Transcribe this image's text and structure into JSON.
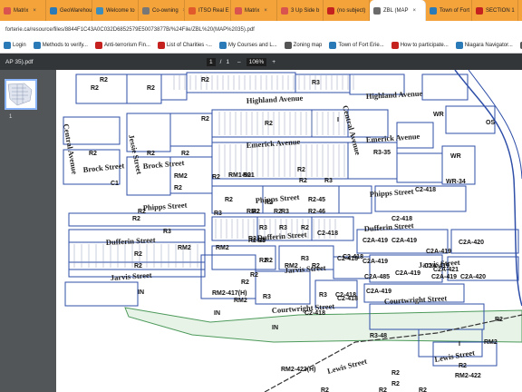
{
  "tabs": [
    {
      "label": "Matrix",
      "active": false,
      "color": "#d9534f"
    },
    {
      "label": "GeoWarehouse",
      "active": false,
      "color": "#2a7ab8"
    },
    {
      "label": "Welcome to",
      "active": false,
      "color": "#3c8dbc"
    },
    {
      "label": "Co-owning",
      "active": false,
      "color": "#777777"
    },
    {
      "label": "ITSO Real E",
      "active": false,
      "color": "#e05a2b"
    },
    {
      "label": "Matrix",
      "active": false,
      "color": "#d9534f"
    },
    {
      "label": "3 Up Side b",
      "active": false,
      "color": "#d9534f"
    },
    {
      "label": "(no subject)",
      "active": false,
      "color": "#c5221f"
    },
    {
      "label": "ZBL (MAP",
      "active": true,
      "color": "#6b6b6b"
    },
    {
      "label": "Town of Fort",
      "active": false,
      "color": "#2a7ab8"
    },
    {
      "label": "SECTION 1",
      "active": false,
      "color": "#c5221f"
    }
  ],
  "url": "forterie.ca/resource/files/8844F1C43A0C032D6852579E50073877B/%24File/ZBL%20(MAP%2035).pdf",
  "bookmarks": [
    {
      "label": "Login",
      "color": "#2a7ab8"
    },
    {
      "label": "Methods to verify...",
      "color": "#2a7ab8"
    },
    {
      "label": "Anti-terrorism Fin...",
      "color": "#c5221f"
    },
    {
      "label": "List of Charities -...",
      "color": "#c5221f"
    },
    {
      "label": "My Courses and L...",
      "color": "#2a7ab8"
    },
    {
      "label": "Zoning map",
      "color": "#555555"
    },
    {
      "label": "Town of Fort Erie...",
      "color": "#2a7ab8"
    },
    {
      "label": "How to participate...",
      "color": "#c5221f"
    },
    {
      "label": "Niagara Navigator...",
      "color": "#2a7ab8"
    },
    {
      "label": "Member and Stud...",
      "color": "#555555"
    },
    {
      "label": "Home - Ar",
      "color": "#555555"
    }
  ],
  "pdf": {
    "title": "AP 35).pdf",
    "page_current": "1",
    "page_sep": "/",
    "page_total": "1",
    "zoom_minus": "–",
    "zoom": "106%",
    "zoom_plus": "+",
    "thumbnail_page": "1"
  },
  "streets": [
    "Highland Avenue",
    "Highland Avenue",
    "Emerick Avenue",
    "Emerick Avenue",
    "Brock Street",
    "Brock Street",
    "Phipps Street",
    "Phipps Street",
    "Phipps Street",
    "Dufferin Street",
    "Dufferin Street",
    "Dufferin Street",
    "Jarvis Street",
    "Jarvis Street",
    "Jarvis Street",
    "Courtwright Street",
    "Courtwright Street",
    "Lewis Street",
    "Lewis Street",
    "Central Avenue",
    "Jessie Street",
    "Central Avenue"
  ],
  "zones": [
    "R2",
    "R2",
    "R3",
    "R2",
    "R2",
    "R2",
    "I",
    "R2",
    "R2",
    "R2",
    "R2",
    "R2",
    "R2",
    "R2",
    "OS",
    "WR",
    "R3-35",
    "WR",
    "C1",
    "R2",
    "RM2",
    "R2",
    "RM1-501",
    "R2",
    "R2",
    "R3",
    "WR-34",
    "R2",
    "R2",
    "R3",
    "R2-45",
    "R2-46",
    "C2-418",
    "C2-418",
    "R2",
    "R3",
    "RM2",
    "R2",
    "R3",
    "R2",
    "R3",
    "R3",
    "R2",
    "RM2",
    "R2-38",
    "R3",
    "C2-418",
    "C2A-419",
    "C2A-419",
    "C2A-420",
    "R2",
    "R2",
    "RM2",
    "R2",
    "R2",
    "C2-418",
    "C2A-419",
    "C2A-419",
    "C2A-419",
    "R2",
    "R3",
    "R2",
    "RM2",
    "C2-418",
    "C2A-485",
    "C2A-419",
    "C2A-421",
    "C2A-419",
    "C2A-420",
    "IN",
    "RM2-417(H)",
    "R3",
    "R2",
    "R3",
    "C2-418",
    "C2A-419",
    "RM2",
    "C2-418",
    "IN",
    "C2-418",
    "IN",
    "R3-48",
    "I",
    "RM2",
    "R2",
    "RM2-423(H)",
    "R2",
    "R2",
    "RM2-422",
    "R2",
    "R2",
    "R2",
    "R2"
  ]
}
